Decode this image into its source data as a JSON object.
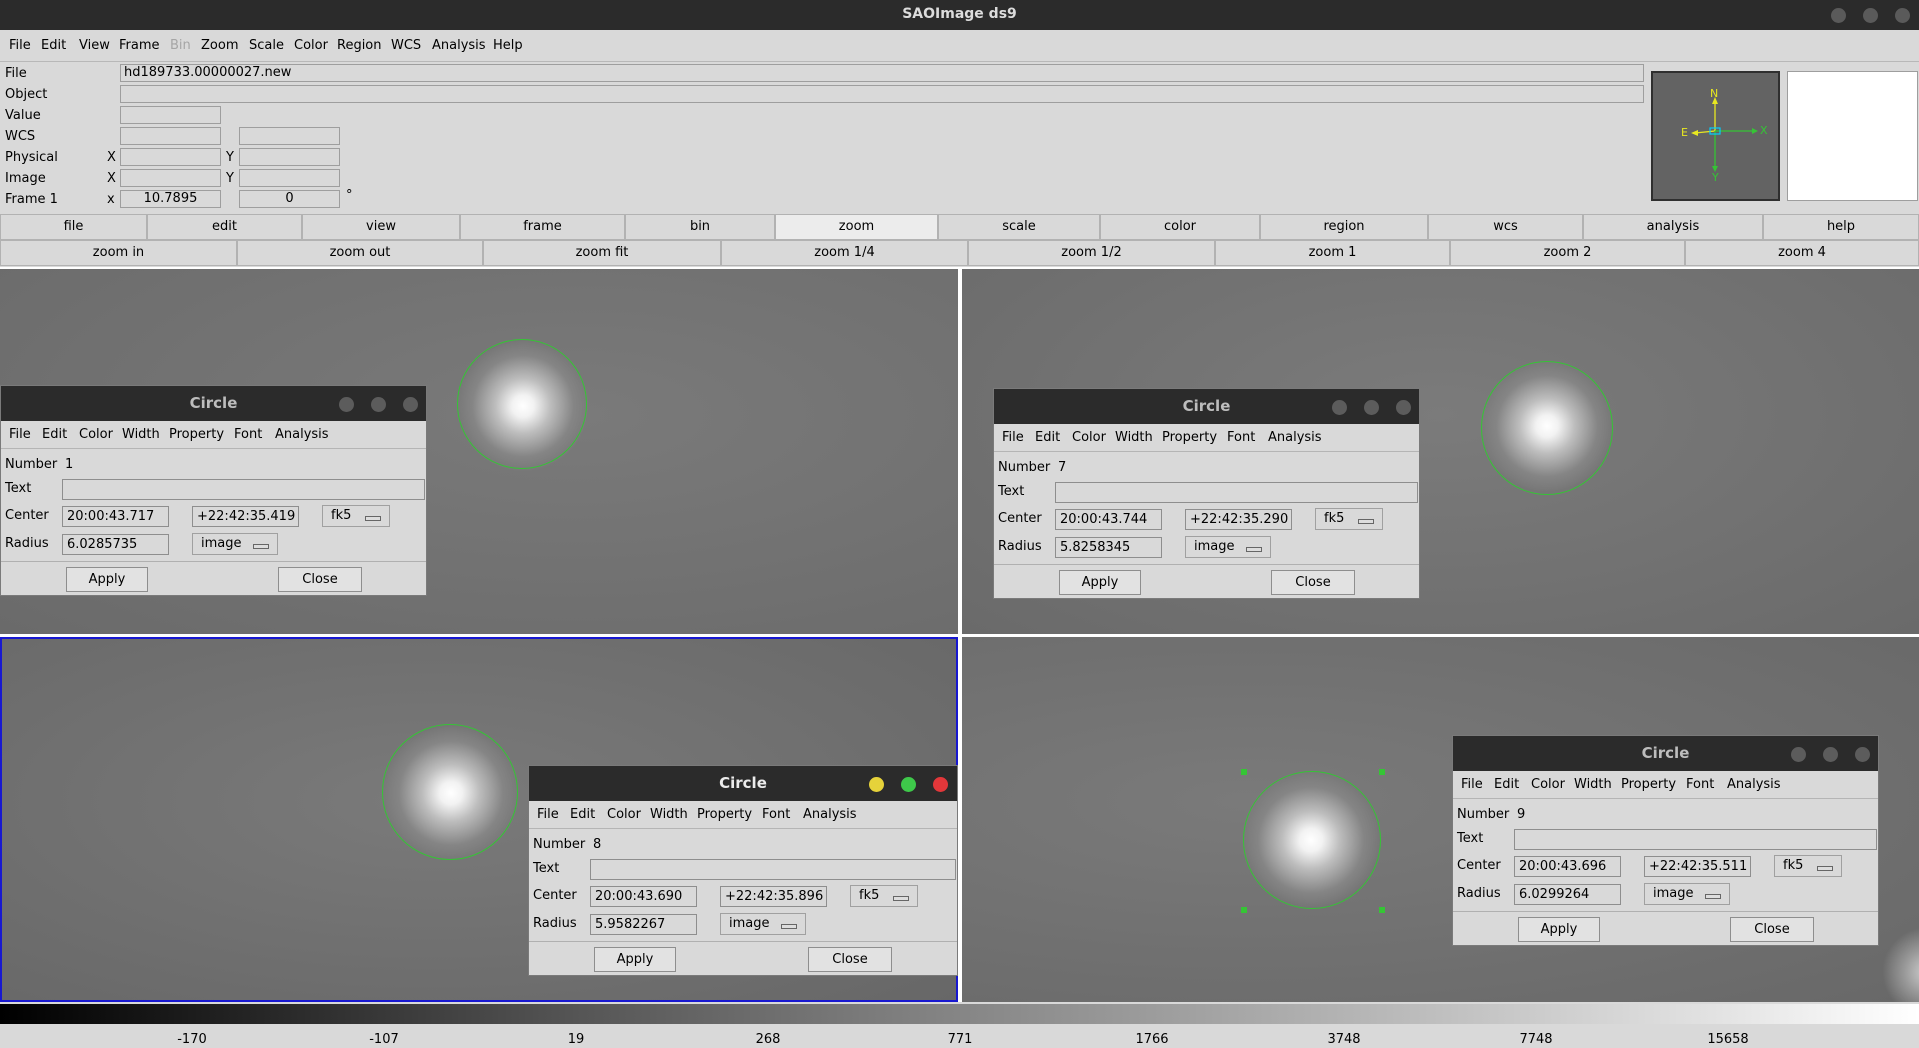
{
  "app": {
    "title": "SAOImage ds9"
  },
  "menubar": [
    "File",
    "Edit",
    "View",
    "Frame",
    "Bin",
    "Zoom",
    "Scale",
    "Color",
    "Region",
    "WCS",
    "Analysis",
    "Help"
  ],
  "info": {
    "file_label": "File",
    "file_value": "hd189733.00000027.new",
    "object_label": "Object",
    "object_value": "",
    "value_label": "Value",
    "value_value": "",
    "wcs_label": "WCS",
    "physical_label": "Physical",
    "image_label": "Image",
    "frame_label": "Frame 1",
    "x_label": "X",
    "y_label": "Y",
    "x_small": "x",
    "frame_zoom": "10.7895",
    "frame_angle": "0",
    "degree": "°"
  },
  "panner": {
    "n": "N",
    "e": "E",
    "x": "X",
    "y": "Y"
  },
  "buttonbar": [
    "file",
    "edit",
    "view",
    "frame",
    "bin",
    "zoom",
    "scale",
    "color",
    "region",
    "wcs",
    "analysis",
    "help"
  ],
  "zoombar": [
    "zoom in",
    "zoom out",
    "zoom fit",
    "zoom 1/4",
    "zoom 1/2",
    "zoom 1",
    "zoom 2",
    "zoom 4"
  ],
  "dialog_common": {
    "title": "Circle",
    "menu": [
      "File",
      "Edit",
      "Color",
      "Width",
      "Property",
      "Font",
      "Analysis"
    ],
    "number_label": "Number",
    "text_label": "Text",
    "center_label": "Center",
    "radius_label": "Radius",
    "coord_system": "fk5",
    "radius_units": "image",
    "apply": "Apply",
    "close": "Close"
  },
  "dialogs": [
    {
      "number": "1",
      "ra": "20:00:43.717",
      "dec": "+22:42:35.419",
      "radius": "6.0285735"
    },
    {
      "number": "7",
      "ra": "20:00:43.744",
      "dec": "+22:42:35.290",
      "radius": "5.8258345"
    },
    {
      "number": "8",
      "ra": "20:00:43.690",
      "dec": "+22:42:35.896",
      "radius": "5.9582267"
    },
    {
      "number": "9",
      "ra": "20:00:43.696",
      "dec": "+22:42:35.511",
      "radius": "6.0299264"
    }
  ],
  "colorbar_ticks": [
    "-170",
    "-107",
    "19",
    "268",
    "771",
    "1766",
    "3748",
    "7748",
    "15658"
  ],
  "colors": {
    "region": "#35c535",
    "active_frame": "#1818d0"
  }
}
